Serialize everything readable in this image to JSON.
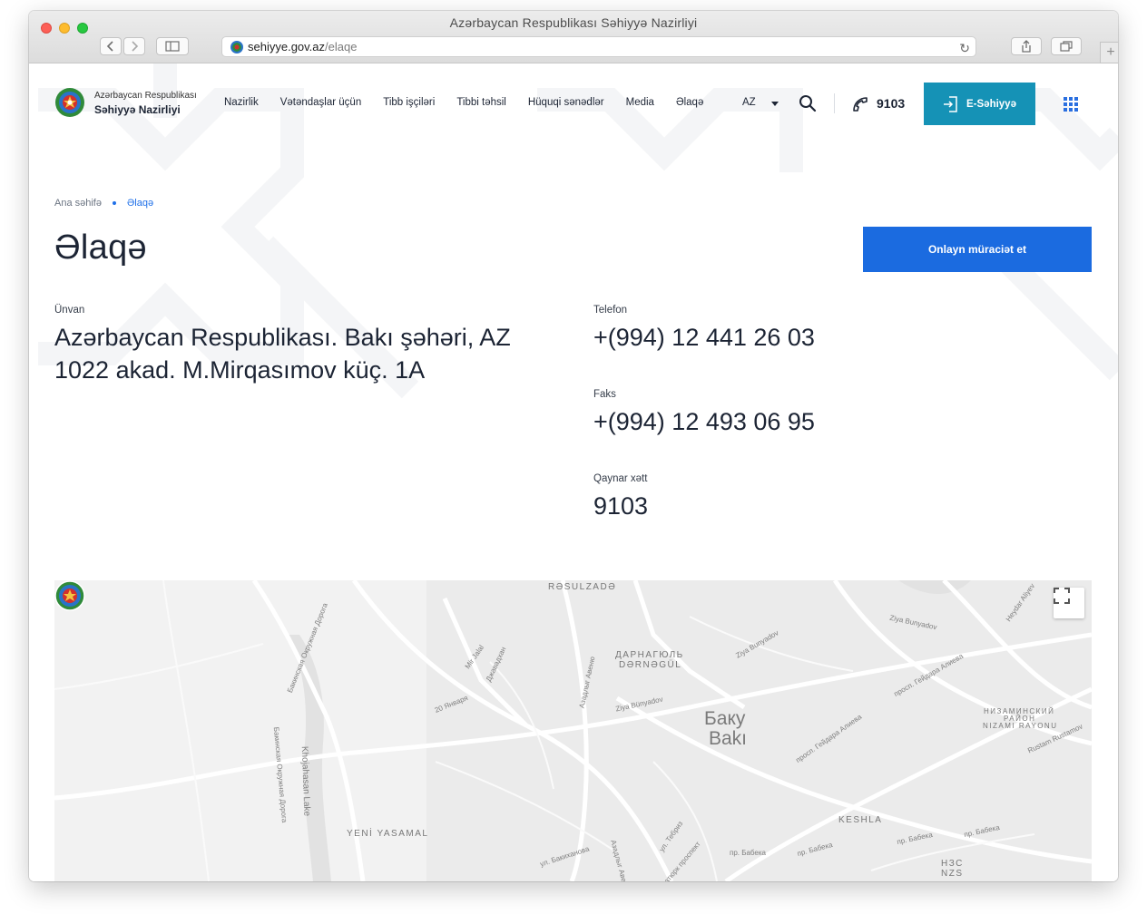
{
  "window": {
    "title": "Azərbaycan Respublikası Səhiyyə Nazirliyi",
    "url_domain": "sehiyye.gov.az",
    "url_path": "/elaqe"
  },
  "header": {
    "logo_small": "Azərbaycan Respublikası",
    "logo_big": "Səhiyyə Nazirliyi",
    "menu": [
      "Nazirlik",
      "Vətəndaşlar üçün",
      "Tibb işçiləri",
      "Tibbi təhsil",
      "Hüquqi sənədlər",
      "Media",
      "Əlaqə"
    ],
    "lang": "AZ",
    "hotline": "9103",
    "eservice_label": "E-Səhiyyə"
  },
  "breadcrumb": {
    "home": "Ana səhifə",
    "current": "Əlaqə"
  },
  "page": {
    "title": "Əlaqə",
    "apply_button": "Onlayn müraciət et"
  },
  "contact": {
    "address_label": "Ünvan",
    "address_line1": "Azərbaycan Respublikası. Bakı şəhəri, AZ",
    "address_line2": "1022 akad. M.Mirqasımov küç. 1A",
    "phone_label": "Telefon",
    "phone": "+(994) 12 441 26 03",
    "fax_label": "Faks",
    "fax": "+(994) 12 493 06 95",
    "hotline_label": "Qaynar xətt",
    "hotline": "9103"
  },
  "map": {
    "city_ru": "Баку",
    "city_az": "Bakı",
    "districts": {
      "rasulzade": "RƏSULZADƏ",
      "darnagul_ru": "ДАРНАГЮЛЬ",
      "darnagul_az": "DƏRNƏGÜL",
      "nizami_ru1": "НИЗАМИНСКИЙ",
      "nizami_ru2": "РАЙОН",
      "nizami_az": "NIZAMI RAYONU",
      "yasamal": "YENİ YASAMAL",
      "keshla": "KESHLA",
      "nzs_ru": "НЗС",
      "nzs_az": "NZS"
    },
    "streets": {
      "ziya1": "Ziya Bunyadov",
      "ziya2": "Ziya Bunyadov",
      "ziya3": "Ziya Bünyadov",
      "ziya4": "Ziya Bunyadov",
      "heydar": "Heydar Aliyev",
      "heydar_ave1": "просп. Гейдара Алиева",
      "heydar_ave2": "просп. Гейдара Алиева",
      "rustam": "Rustam Rustamov",
      "mirjalal": "Mir Jalal",
      "dzhavad": "Джавадхан",
      "january": "20 Января",
      "azadlyg": "Азадлыг Авеню",
      "ring1": "Бакинская Окружная Дорога",
      "ring2": "Бакинская Окружная Дорога",
      "lake": "Khojahasan Lake",
      "tabriz": "ул. Тебриз",
      "bakikhanov": "ул. Бакиханова",
      "azadlyg2": "Азадлыг Авеню",
      "babek1": "пр. Бабека",
      "babek2": "пр. Бабека",
      "babek3": "пр. Бабека",
      "babek4": "пр. Бабека",
      "atatyurk": "Ататюрк проспект"
    }
  }
}
